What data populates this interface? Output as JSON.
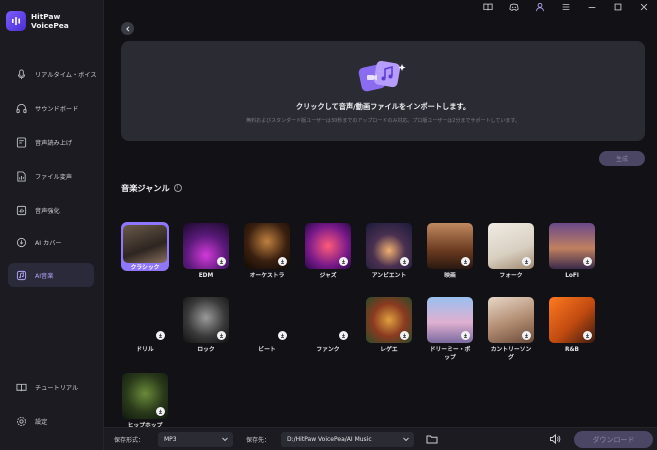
{
  "app": {
    "name_line1": "HitPaw",
    "name_line2": "VoicePea"
  },
  "sidebar": {
    "items": [
      {
        "label": "リアルタイム・ボイス",
        "icon": "microphone-icon"
      },
      {
        "label": "サウンドボード",
        "icon": "headphones-icon"
      },
      {
        "label": "音声読み上げ",
        "icon": "text-to-speech-icon"
      },
      {
        "label": "ファイル変声",
        "icon": "file-voice-icon"
      },
      {
        "label": "音声強化",
        "icon": "enhance-icon"
      },
      {
        "label": "AI カバー",
        "icon": "ai-cover-icon"
      },
      {
        "label": "AI音楽",
        "icon": "ai-music-icon",
        "active": true
      }
    ],
    "bottom_items": [
      {
        "label": "チュートリアル",
        "icon": "book-icon"
      },
      {
        "label": "設定",
        "icon": "settings-icon"
      }
    ]
  },
  "titlebar": {
    "icons": [
      "guide-book-icon",
      "discord-icon",
      "user-icon",
      "menu-icon",
      "minimize-icon",
      "maximize-icon",
      "close-icon"
    ]
  },
  "import": {
    "title": "クリックして音声/動画ファイルをインポートします。",
    "subtitle": "無料およびスタンダード版ユーザーは30秒までのアップロードのみ対応。プロ版ユーザーは2分までサポートしています。"
  },
  "generate_label": "生成",
  "genre_section": {
    "title": "音楽ジャンル",
    "info": "i"
  },
  "genres": [
    {
      "label": "クラシック",
      "selected": true,
      "bg": "linear-gradient(160deg,#6a5a4a,#2d2520 60%,#8a7060)"
    },
    {
      "label": "EDM",
      "bg": "radial-gradient(circle at 50% 70%,#d23ad8,#5a1a7a 50%,#1a0a2a)"
    },
    {
      "label": "オーケストラ",
      "bg": "radial-gradient(circle at 50% 40%,#c08040,#3a2010 55%,#100805)"
    },
    {
      "label": "ジャズ",
      "bg": "radial-gradient(circle at 50% 50%,#ff5a7a,#7a1a8a 60%,#2a0a4a)"
    },
    {
      "label": "アンビエント",
      "bg": "radial-gradient(circle at 50% 60%,#f0b070,#4a3050 45%,#1a1a3a)"
    },
    {
      "label": "映画",
      "bg": "linear-gradient(180deg,#c08a60,#6a3a20 60%,#2a1810)"
    },
    {
      "label": "フォーク",
      "bg": "linear-gradient(160deg,#f0ece4,#d8cfc0 60%,#a08a70)"
    },
    {
      "label": "LoFi",
      "bg": "linear-gradient(180deg,#6a4a8a,#c08060 55%,#3a2a4a)"
    },
    {
      "label": "ドリル",
      "bg": "blank"
    },
    {
      "label": "ロック",
      "bg": "radial-gradient(circle at 50% 45%,#9a9a9a,#3a3a3a 55%,#101010)"
    },
    {
      "label": "ビート",
      "bg": "blank"
    },
    {
      "label": "ファンク",
      "bg": "blank"
    },
    {
      "label": "レゲエ",
      "bg": "radial-gradient(circle at 50% 50%,#e0a040,#8a3a20 50%,#2a4a2a)"
    },
    {
      "label": "ドリーミー・ポップ",
      "bg": "linear-gradient(180deg,#9ac0f0,#e0b0d0 55%,#7a6aa0)"
    },
    {
      "label": "カントリーソング",
      "bg": "linear-gradient(160deg,#e8d8c8,#b08a70 55%,#6a4a3a)"
    },
    {
      "label": "R&B",
      "bg": "linear-gradient(135deg,#ff7a20,#c04a10 55%,#3a1a10)"
    },
    {
      "label": "ヒップホップ",
      "bg": "radial-gradient(circle at 50% 45%,#6a8a3a,#2a3a1a 55%,#101810)"
    }
  ],
  "bottom_bar": {
    "format_label": "保存形式：",
    "format_value": "MP3",
    "path_label": "保存先：",
    "path_value": "D:/HitPaw VoicePea/AI Music",
    "download_label": "ダウンロード"
  },
  "colors": {
    "accent": "#8e76ff",
    "background": "#121216",
    "sidebar": "#1b1b21",
    "panel": "#2b2b33"
  }
}
